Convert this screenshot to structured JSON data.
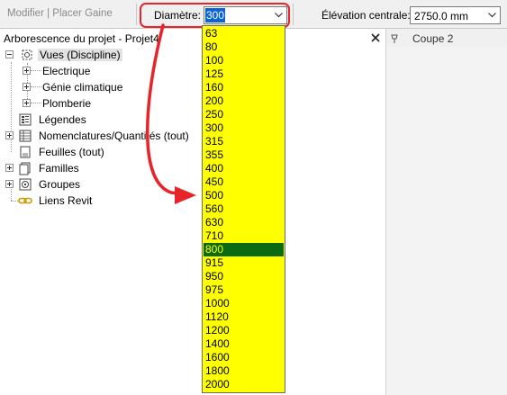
{
  "options_bar": {
    "mode_label": "Modifier | Placer Gaine",
    "diameter_label": "Diamètre:",
    "diameter_value": "300",
    "elevation_label": "Élévation centrale:",
    "elevation_value": "2750.0 mm"
  },
  "browser": {
    "title": "Arborescence du projet - Projet4",
    "nodes": [
      {
        "label": "Vues (Discipline)",
        "icon": "views-icon"
      },
      {
        "label": "Electrique"
      },
      {
        "label": "Génie climatique"
      },
      {
        "label": "Plomberie"
      },
      {
        "label": "Légendes",
        "icon": "legends-icon"
      },
      {
        "label": "Nomenclatures/Quantités (tout)",
        "icon": "schedules-icon"
      },
      {
        "label": "Feuilles (tout)",
        "icon": "sheets-icon"
      },
      {
        "label": "Familles",
        "icon": "families-icon"
      },
      {
        "label": "Groupes",
        "icon": "groups-icon"
      },
      {
        "label": "Liens Revit",
        "icon": "revit-links-icon"
      }
    ]
  },
  "view_tab": {
    "label": "Coupe 2"
  },
  "dropdown": {
    "selected": "800",
    "options": [
      "63",
      "80",
      "100",
      "125",
      "160",
      "200",
      "250",
      "300",
      "315",
      "355",
      "400",
      "450",
      "500",
      "560",
      "630",
      "710",
      "800",
      "915",
      "950",
      "975",
      "1000",
      "1120",
      "1200",
      "1400",
      "1600",
      "1800",
      "2000"
    ]
  },
  "colors": {
    "highlight_box": "#e8242b",
    "annotation_arrow": "#e8242b",
    "dropdown_background": "#ffff00",
    "dropdown_selected": "#0a6b12",
    "input_selection": "#0a64d6"
  }
}
